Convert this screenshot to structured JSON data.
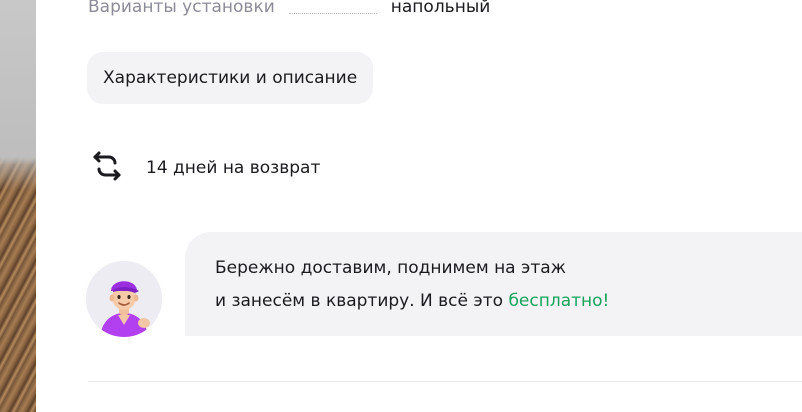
{
  "spec": {
    "label": "Варианты установки",
    "value": "напольный"
  },
  "characteristics_button": "Характеристики и описание",
  "returns": {
    "icon": "return-arrows-icon",
    "text": "14 дней на возврат"
  },
  "delivery": {
    "line1": "Бережно доставим, поднимем на этаж",
    "line2_prefix": "и занесём в квартиру. И всё это ",
    "line2_highlight": "бесплатно!",
    "avatar_icon": "courier-avatar"
  },
  "colors": {
    "accent": "#17a35b",
    "bubble_bg": "#f3f3f6",
    "muted_text": "#8c8c99"
  }
}
